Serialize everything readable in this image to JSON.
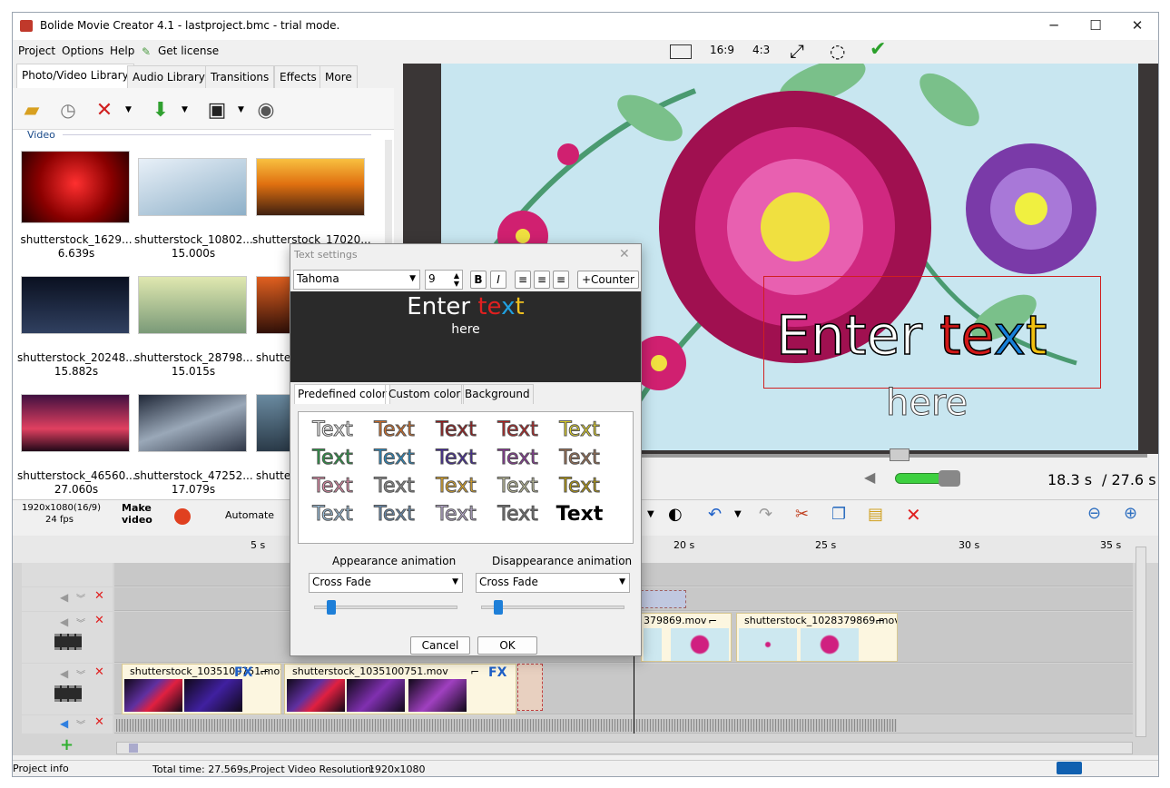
{
  "window": {
    "title": "Bolide Movie Creator 4.1 - lastproject.bmc - trial mode.",
    "controls": {
      "minimize": "─",
      "maximize": "☐",
      "close": "✕"
    }
  },
  "menu": {
    "project": "Project",
    "options": "Options",
    "help": "Help",
    "license": "Get license"
  },
  "library_tabs": [
    "Photo/Video Library",
    "Audio Library",
    "Transitions",
    "Effects",
    "More"
  ],
  "library": {
    "section": "Video",
    "items": [
      {
        "name": "shutterstock_1629...",
        "duration": "6.639s",
        "color": "#b01010"
      },
      {
        "name": "shutterstock_10802...",
        "duration": "15.000s",
        "color": "#a8c4d8"
      },
      {
        "name": "shutterstock_17020...",
        "duration": "",
        "color": "#d88020"
      },
      {
        "name": "shutterstock_20248...",
        "duration": "15.882s",
        "color": "#1c2a40"
      },
      {
        "name": "shutterstock_28798...",
        "duration": "15.015s",
        "color": "#b8c890"
      },
      {
        "name": "shutter",
        "duration": "",
        "color": "#803010"
      },
      {
        "name": "shutterstock_46560...",
        "duration": "27.060s",
        "color": "#702040"
      },
      {
        "name": "shutterstock_47252...",
        "duration": "17.079s",
        "color": "#5a6070"
      },
      {
        "name": "shutter",
        "duration": "",
        "color": "#4a6a80"
      }
    ]
  },
  "preview_top": {
    "ratio_169": "16:9",
    "ratio_43": "4:3"
  },
  "preview": {
    "text_line1_a": "Enter ",
    "text_line1_b": "te",
    "text_line1_c": "x",
    "text_line1_d": "t",
    "text_line2": "here",
    "time_current": "18.3 s",
    "time_total": "/ 27.6 s"
  },
  "timeline_bar": {
    "resolution": "1920x1080(16/9)",
    "fps": "24 fps",
    "make_video_1": "Make",
    "make_video_2": "video",
    "automate": "Automate"
  },
  "ruler": [
    "5 s",
    "20 s",
    "25 s",
    "30 s",
    "35 s"
  ],
  "tracks": {
    "clip_a": "379869.mov",
    "clip_b": "shutterstock_1028379869.mov",
    "clip_c": "shutterstock_1035100751.mov",
    "clip_d": "shutterstock_1035100751.mov",
    "fx": "FX"
  },
  "status": {
    "info": "Project info",
    "total": "Total time: 27.569s,",
    "res_label": "Project Video Resolution:",
    "res_value": "1920x1080"
  },
  "dialog": {
    "title": "Text settings",
    "font": "Tahoma",
    "size": "9",
    "counter": "+Counter",
    "preview_a": "Enter ",
    "preview_b": "te",
    "preview_c": "x",
    "preview_d": "t",
    "preview_line2": "here",
    "tabs": [
      "Predefined color",
      "Custom color",
      "Background"
    ],
    "sample_word": "Text",
    "appearance_label": "Appearance animation",
    "disappearance_label": "Disappearance animation",
    "appearance_value": "Cross Fade",
    "disappearance_value": "Cross Fade",
    "cancel": "Cancel",
    "ok": "OK"
  },
  "colors": {
    "accent_blue": "#1e7fd8",
    "preset_rows": [
      [
        "#ffffff",
        "#e07020",
        "#a01010",
        "#c01818",
        "#f0e020"
      ],
      [
        "#20a040",
        "#2090d0",
        "#4020a0",
        "#9030a0",
        "#a07050"
      ],
      [
        "#f090b0",
        "#909090",
        "#f0b020",
        "#c8c8a0",
        "#c0a000"
      ],
      [
        "#a0c8e8",
        "#6890b8",
        "#c0b0d8",
        "#707070",
        "#000000"
      ]
    ]
  }
}
